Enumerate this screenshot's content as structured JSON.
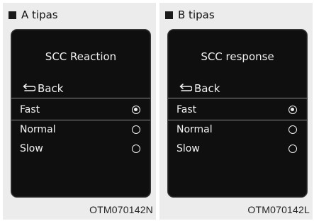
{
  "panels": [
    {
      "heading": "A tipas",
      "screen_title": "SCC Reaction",
      "back_label": "Back",
      "options": [
        {
          "label": "Fast",
          "selected": true
        },
        {
          "label": "Normal",
          "selected": false
        },
        {
          "label": "Slow",
          "selected": false
        }
      ],
      "caption": "OTM070142N"
    },
    {
      "heading": "B tipas",
      "screen_title": "SCC response",
      "back_label": "Back",
      "options": [
        {
          "label": "Fast",
          "selected": true
        },
        {
          "label": "Normal",
          "selected": false
        },
        {
          "label": "Slow",
          "selected": false
        }
      ],
      "caption": "OTM070142L"
    }
  ]
}
